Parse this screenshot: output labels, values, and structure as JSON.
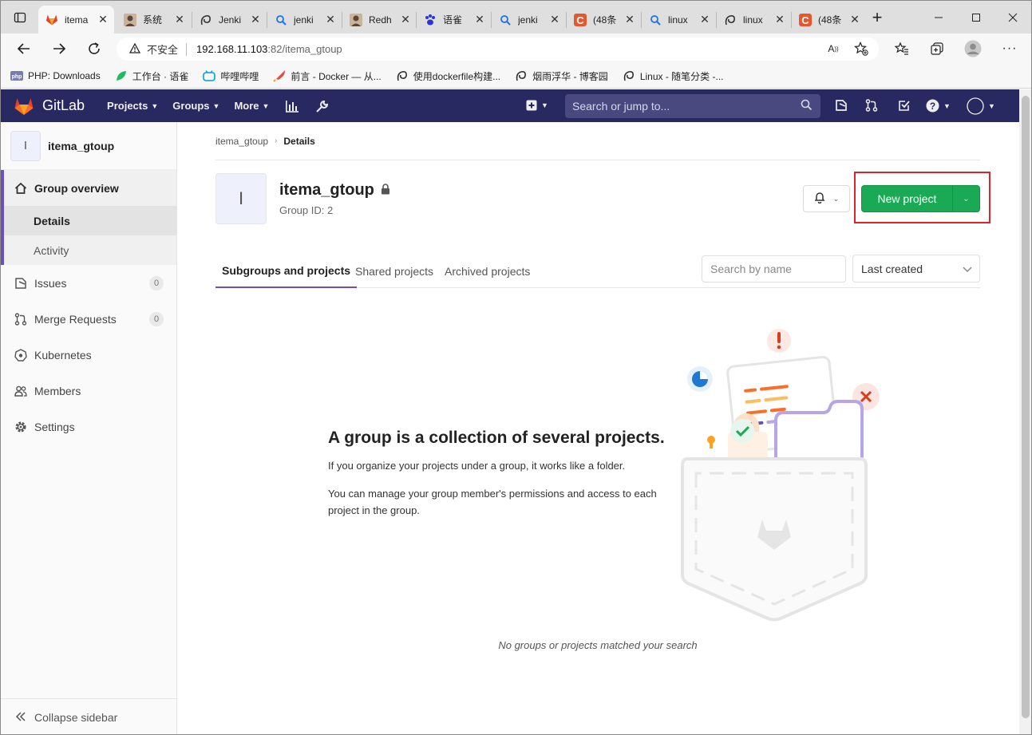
{
  "browser": {
    "tabs": [
      {
        "label": "itema",
        "icon": "gitlab-icon",
        "active": true
      },
      {
        "label": "系统",
        "icon": "avatar-icon"
      },
      {
        "label": "Jenki",
        "icon": "spiral-icon"
      },
      {
        "label": "jenki",
        "icon": "search-icon"
      },
      {
        "label": "Redh",
        "icon": "avatar-icon"
      },
      {
        "label": "语雀",
        "icon": "paw-icon"
      },
      {
        "label": "jenki",
        "icon": "search-icon"
      },
      {
        "label": "(48条",
        "icon": "csdn-icon"
      },
      {
        "label": "linux",
        "icon": "search-icon"
      },
      {
        "label": "linux",
        "icon": "spiral-icon"
      },
      {
        "label": "(48条",
        "icon": "csdn-icon"
      }
    ],
    "address": {
      "insecure_label": "不安全",
      "host": "192.168.11.103",
      "rest": ":82/itema_gtoup"
    },
    "bookmarks": [
      {
        "label": "PHP: Downloads",
        "icon": "php-icon"
      },
      {
        "label": "工作台 · 语雀",
        "icon": "leaf-icon"
      },
      {
        "label": "哔哩哔哩",
        "icon": "bilibili-icon"
      },
      {
        "label": "前言 - Docker — 从...",
        "icon": "rocket-icon"
      },
      {
        "label": "使用dockerfile构建...",
        "icon": "spiral-icon"
      },
      {
        "label": "烟雨浮华 - 博客园",
        "icon": "spiral-icon"
      },
      {
        "label": "Linux - 随笔分类 -...",
        "icon": "spiral-icon"
      }
    ]
  },
  "gitlab": {
    "brand": "GitLab",
    "menus": [
      "Projects",
      "Groups",
      "More"
    ],
    "search_placeholder": "Search or jump to..."
  },
  "sidebar": {
    "avatar_letter": "I",
    "group_name": "itema_gtoup",
    "overview_label": "Group overview",
    "sub_items": [
      "Details",
      "Activity"
    ],
    "items": [
      {
        "label": "Issues",
        "count": "0",
        "icon": "issues-icon"
      },
      {
        "label": "Merge Requests",
        "count": "0",
        "icon": "merge-request-icon"
      },
      {
        "label": "Kubernetes",
        "icon": "kubernetes-icon"
      },
      {
        "label": "Members",
        "icon": "members-icon"
      },
      {
        "label": "Settings",
        "icon": "settings-icon"
      }
    ],
    "collapse_label": "Collapse sidebar"
  },
  "main": {
    "breadcrumb": [
      "itema_gtoup",
      "Details"
    ],
    "avatar_letter": "I",
    "group_title": "itema_gtoup",
    "group_id": "Group ID: 2",
    "new_project_label": "New project",
    "tabs": [
      "Subgroups and projects",
      "Shared projects",
      "Archived projects"
    ],
    "search_placeholder": "Search by name",
    "sort_value": "Last created",
    "empty_title": "A group is a collection of several projects.",
    "empty_p1": "If you organize your projects under a group, it works like a folder.",
    "empty_p2": "You can manage your group member's permissions and access to each project in the group.",
    "no_match": "No groups or projects matched your search"
  },
  "colors": {
    "navbar": "#292961",
    "primary_green": "#1aaa55",
    "accent_purple": "#6b4fbb",
    "highlight_red": "#d9252b"
  }
}
